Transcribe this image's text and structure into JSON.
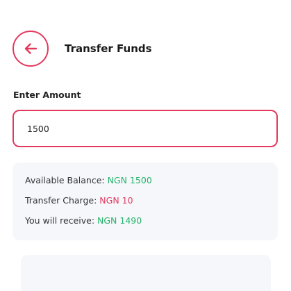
{
  "header": {
    "title": "Transfer Funds",
    "back_icon": "arrow-left-icon",
    "accent_color": "#e4385d"
  },
  "amount": {
    "label": "Enter Amount",
    "value": "1500"
  },
  "summary": {
    "available_label": "Available Balance: ",
    "available_value": "NGN 1500",
    "charge_label": "Transfer Charge: ",
    "charge_value": "NGN 10",
    "receive_label": "You will receive: ",
    "receive_value": "NGN 1490",
    "positive_color": "#25b36a",
    "negative_color": "#e4385d"
  }
}
